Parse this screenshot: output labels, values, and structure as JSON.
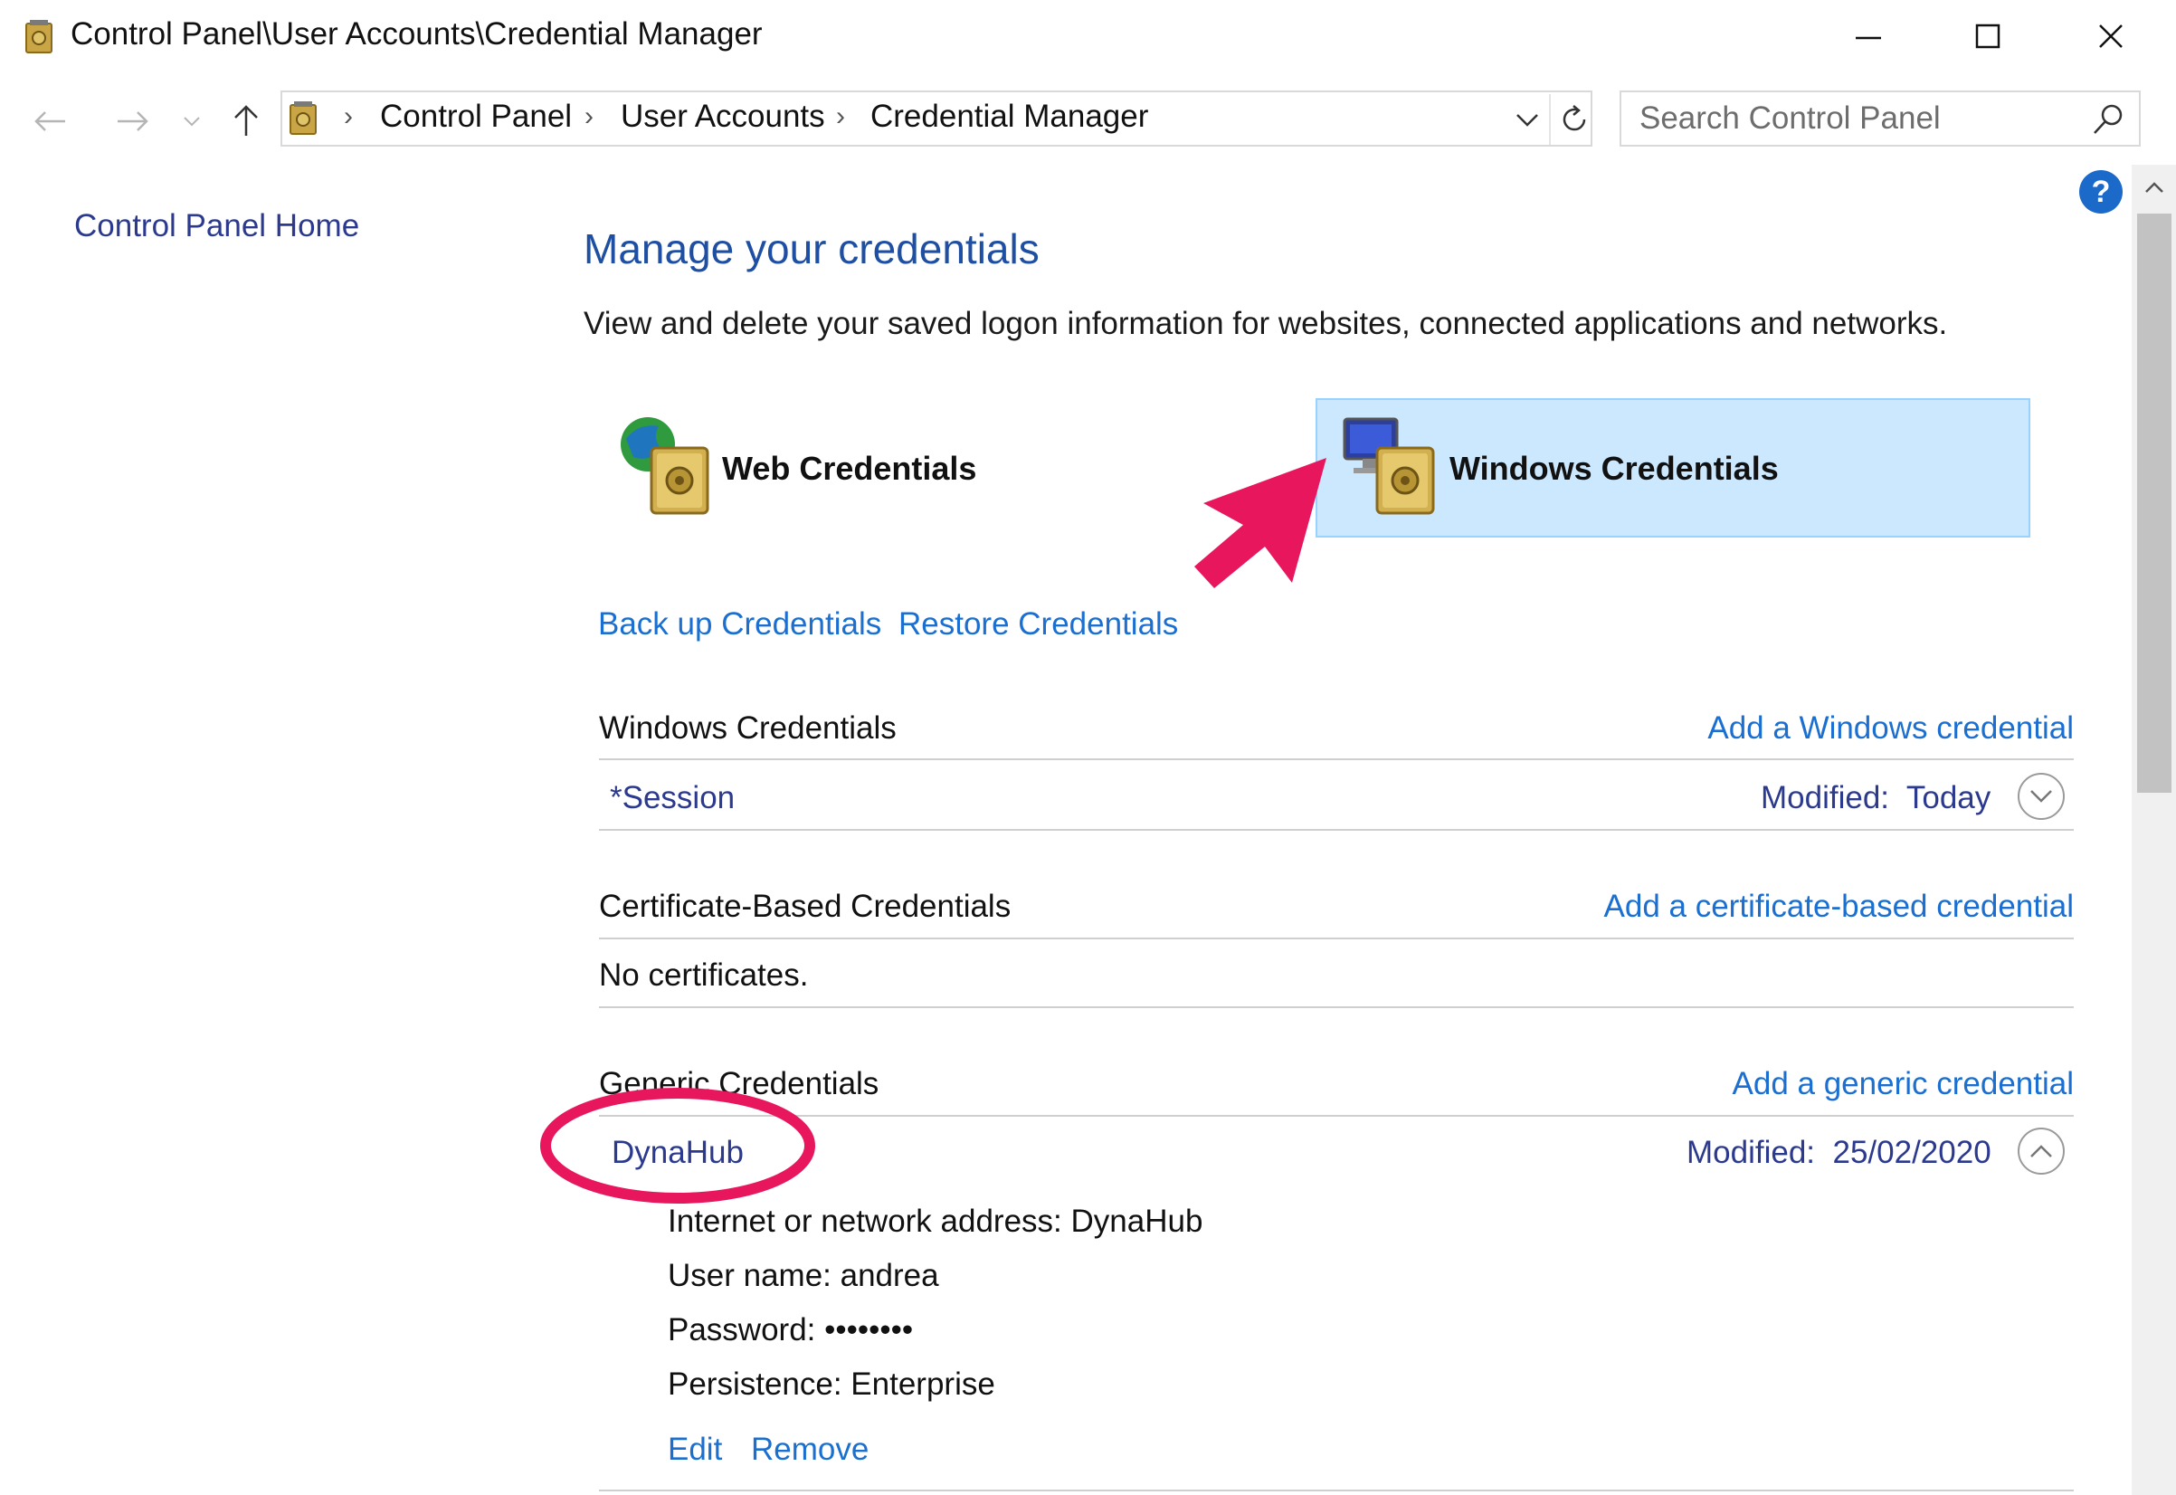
{
  "window": {
    "title": "Control Panel\\User Accounts\\Credential Manager",
    "controls": {
      "minimize": "minimize",
      "maximize": "maximize",
      "close": "close"
    }
  },
  "address_bar": {
    "breadcrumbs": [
      "Control Panel",
      "User Accounts",
      "Credential Manager"
    ]
  },
  "search": {
    "placeholder": "Search Control Panel"
  },
  "help": {
    "label": "?"
  },
  "left_pane": {
    "home_link": "Control Panel Home"
  },
  "main": {
    "title": "Manage your credentials",
    "description": "View and delete your saved logon information for websites, connected applications and networks.",
    "tiles": [
      {
        "label": "Web Credentials",
        "selected": false,
        "icon": "web-credentials-vault-icon"
      },
      {
        "label": "Windows Credentials",
        "selected": true,
        "icon": "windows-credentials-vault-icon"
      }
    ],
    "backup_link": "Back up Credentials",
    "restore_link": "Restore Credentials",
    "sections": {
      "windows": {
        "heading": "Windows Credentials",
        "add_link": "Add a Windows credential",
        "items": [
          {
            "name": "*Session",
            "modified_label": "Modified:",
            "modified_value": "Today",
            "expanded": false
          }
        ]
      },
      "certificate": {
        "heading": "Certificate-Based Credentials",
        "add_link": "Add a certificate-based credential",
        "empty_text": "No certificates."
      },
      "generic": {
        "heading": "Generic Credentials",
        "add_link": "Add a generic credential",
        "items": [
          {
            "name": "DynaHub",
            "modified_label": "Modified:",
            "modified_value": "25/02/2020",
            "expanded": true,
            "details": {
              "address": "Internet or network address:  DynaHub",
              "username": "User name:  andrea",
              "password": "Password:  ••••••••",
              "persistence": "Persistence:  Enterprise"
            },
            "actions": {
              "edit": "Edit",
              "remove": "Remove"
            }
          }
        ]
      }
    }
  },
  "colors": {
    "link": "#1a6fd0",
    "title": "#1f4fa3",
    "selected_tile_bg": "#cce8ff",
    "selected_tile_border": "#99d1ff",
    "annotation": "#e8175d"
  }
}
